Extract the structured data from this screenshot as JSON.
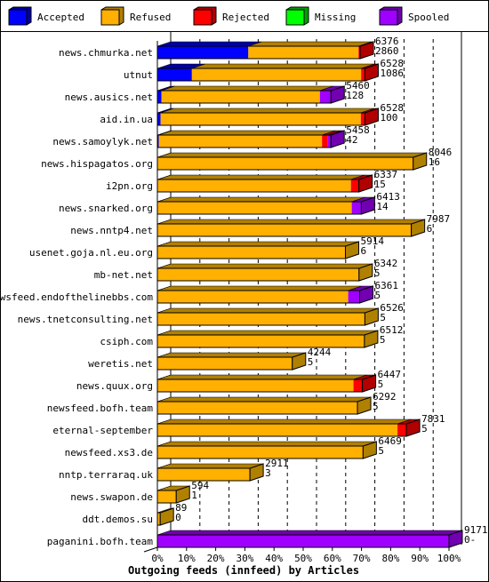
{
  "chart_data": {
    "type": "bar",
    "orientation": "horizontal",
    "stacked": true,
    "title": "",
    "xlabel": "Outgoing feeds (innfeed) by Articles",
    "ylabel": "",
    "xlim": [
      0,
      100
    ],
    "x_unit": "percent of max total (9171)",
    "x_ticks": [
      "0%",
      "10%",
      "20%",
      "30%",
      "40%",
      "50%",
      "60%",
      "70%",
      "80%",
      "90%",
      "100%"
    ],
    "grid": true,
    "legend_position": "top",
    "legend": [
      {
        "name": "Accepted",
        "color": "#0000ff",
        "side": "#0000a0"
      },
      {
        "name": "Refused",
        "color": "#ffb000",
        "side": "#b08000"
      },
      {
        "name": "Rejected",
        "color": "#ff0000",
        "side": "#b00000"
      },
      {
        "name": "Missing",
        "color": "#00ff00",
        "side": "#00a000"
      },
      {
        "name": "Spooled",
        "color": "#a000ff",
        "side": "#7000b0"
      }
    ],
    "max_total": 9171,
    "categories": [
      "news.chmurka.net",
      "utnut",
      "news.ausics.net",
      "aid.in.ua",
      "news.samoylyk.net",
      "news.hispagatos.org",
      "i2pn.org",
      "news.snarked.org",
      "news.nntp4.net",
      "usenet.goja.nl.eu.org",
      "mb-net.net",
      "newsfeed.endofthelinebbs.com",
      "news.tnetconsulting.net",
      "csiph.com",
      "weretis.net",
      "news.quux.org",
      "newsfeed.bofh.team",
      "eternal-september",
      "newsfeed.xs3.de",
      "nntp.terraraq.uk",
      "news.swapon.de",
      "ddt.demos.su",
      "paganini.bofh.team"
    ],
    "totals": [
      6376,
      6528,
      5460,
      6528,
      5458,
      8046,
      6337,
      6413,
      7987,
      5914,
      6342,
      6361,
      6526,
      6512,
      4244,
      6447,
      6292,
      7831,
      6469,
      2911,
      594,
      89,
      9171
    ],
    "accepted_labels": [
      "2860",
      "1086",
      "128",
      "100",
      "42",
      "16",
      "15",
      "14",
      "6",
      "6",
      "5",
      "5",
      "5",
      "5",
      "5",
      "5",
      "5",
      "5",
      "5",
      "3",
      "1",
      "0",
      "0-"
    ],
    "series": [
      {
        "name": "Accepted",
        "values": [
          2860,
          1086,
          128,
          100,
          42,
          16,
          15,
          14,
          6,
          6,
          5,
          5,
          5,
          5,
          5,
          5,
          5,
          5,
          5,
          3,
          1,
          0,
          0
        ]
      },
      {
        "name": "Refused",
        "values": [
          3466,
          5322,
          4982,
          6298,
          5136,
          8030,
          6072,
          6099,
          7981,
          5908,
          6337,
          5996,
          6521,
          6507,
          4239,
          6162,
          6287,
          7546,
          6464,
          2908,
          593,
          89,
          0
        ]
      },
      {
        "name": "Rejected",
        "values": [
          50,
          120,
          0,
          130,
          180,
          0,
          250,
          0,
          0,
          0,
          0,
          0,
          0,
          0,
          0,
          280,
          0,
          280,
          0,
          0,
          0,
          0,
          0
        ]
      },
      {
        "name": "Missing",
        "values": [
          0,
          0,
          0,
          0,
          0,
          0,
          0,
          0,
          0,
          0,
          0,
          0,
          0,
          0,
          0,
          0,
          0,
          0,
          0,
          0,
          0,
          0,
          0
        ]
      },
      {
        "name": "Spooled",
        "values": [
          0,
          0,
          350,
          0,
          100,
          0,
          0,
          300,
          0,
          0,
          0,
          360,
          0,
          0,
          0,
          0,
          0,
          0,
          0,
          0,
          0,
          0,
          9171
        ]
      }
    ]
  }
}
